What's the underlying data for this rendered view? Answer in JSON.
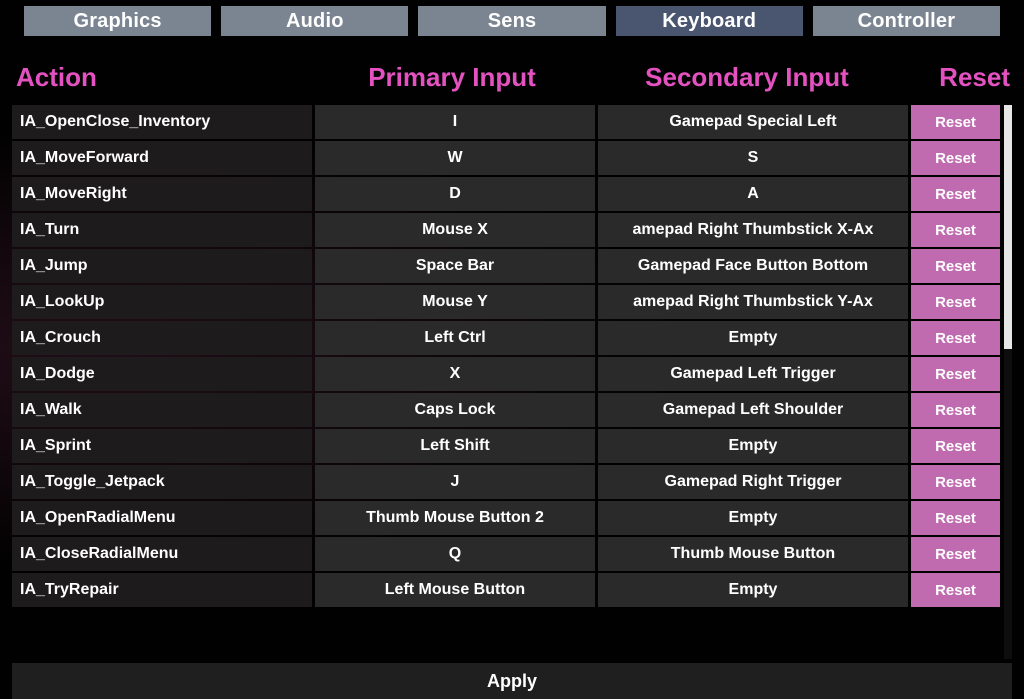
{
  "tabs": [
    {
      "label": "Graphics",
      "active": false
    },
    {
      "label": "Audio",
      "active": false
    },
    {
      "label": "Sens",
      "active": false
    },
    {
      "label": "Keyboard",
      "active": true
    },
    {
      "label": "Controller",
      "active": false
    }
  ],
  "headers": {
    "action": "Action",
    "primary": "Primary Input",
    "secondary": "Secondary Input",
    "reset": "Reset"
  },
  "reset_label": "Reset",
  "apply_label": "Apply",
  "bindings": [
    {
      "action": "IA_OpenClose_Inventory",
      "primary": "I",
      "secondary": "Gamepad Special Left"
    },
    {
      "action": "IA_MoveForward",
      "primary": "W",
      "secondary": "S"
    },
    {
      "action": "IA_MoveRight",
      "primary": "D",
      "secondary": "A"
    },
    {
      "action": "IA_Turn",
      "primary": "Mouse X",
      "secondary": "amepad Right Thumbstick X-Ax"
    },
    {
      "action": "IA_Jump",
      "primary": "Space Bar",
      "secondary": "Gamepad Face Button Bottom"
    },
    {
      "action": "IA_LookUp",
      "primary": "Mouse Y",
      "secondary": "amepad Right Thumbstick Y-Ax"
    },
    {
      "action": "IA_Crouch",
      "primary": "Left Ctrl",
      "secondary": "Empty"
    },
    {
      "action": "IA_Dodge",
      "primary": "X",
      "secondary": "Gamepad Left Trigger"
    },
    {
      "action": "IA_Walk",
      "primary": "Caps Lock",
      "secondary": "Gamepad Left Shoulder"
    },
    {
      "action": "IA_Sprint",
      "primary": "Left Shift",
      "secondary": "Empty"
    },
    {
      "action": "IA_Toggle_Jetpack",
      "primary": "J",
      "secondary": "Gamepad Right Trigger"
    },
    {
      "action": "IA_OpenRadialMenu",
      "primary": "Thumb Mouse Button 2",
      "secondary": "Empty"
    },
    {
      "action": "IA_CloseRadialMenu",
      "primary": "Q",
      "secondary": "Thumb Mouse Button"
    },
    {
      "action": "IA_TryRepair",
      "primary": "Left Mouse Button",
      "secondary": "Empty"
    }
  ]
}
